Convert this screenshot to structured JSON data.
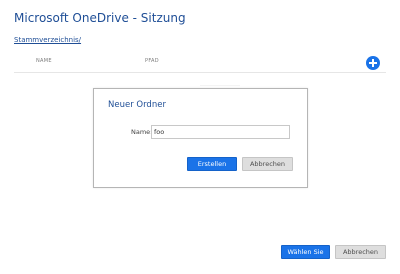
{
  "window": {
    "title": "Microsoft OneDrive - Sitzung"
  },
  "breadcrumb": {
    "root_label": "Stammverzeichnis/"
  },
  "table": {
    "columns": [
      "NAME",
      "PFAD"
    ]
  },
  "actions": {
    "add_icon": "plus-circle-icon",
    "choose_label": "Wählen Sie",
    "cancel_label": "Abbrechen"
  },
  "dialog": {
    "title": "Neuer Ordner",
    "name_label": "Name:",
    "name_value": "foo",
    "create_label": "Erstellen",
    "cancel_label": "Abbrechen"
  },
  "colors": {
    "accent": "#1a73e8",
    "title": "#1f4e96",
    "secondary_button": "#dedede"
  }
}
